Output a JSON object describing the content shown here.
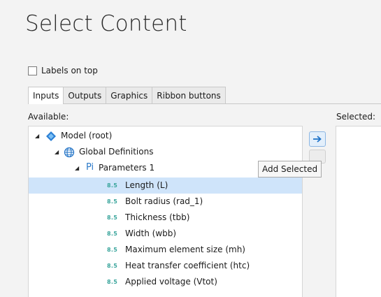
{
  "title": "Select Content",
  "labels_on_top": {
    "label": "Labels on top",
    "checked": false
  },
  "tabs": [
    {
      "label": "Inputs",
      "active": true
    },
    {
      "label": "Outputs",
      "active": false
    },
    {
      "label": "Graphics",
      "active": false
    },
    {
      "label": "Ribbon buttons",
      "active": false
    }
  ],
  "available_label": "Available:",
  "selected_label": "Selected:",
  "tooltip": "Add Selected",
  "tree": {
    "root": "Model (root)",
    "global_definitions": "Global Definitions",
    "parameters_group": "Parameters 1",
    "parameters_icon": "Pi",
    "param_badge": "8.5",
    "parameters": [
      {
        "label": "Length (L)",
        "selected": true
      },
      {
        "label": "Bolt radius (rad_1)",
        "selected": false
      },
      {
        "label": "Thickness (tbb)",
        "selected": false
      },
      {
        "label": "Width (wbb)",
        "selected": false
      },
      {
        "label": "Maximum element size (mh)",
        "selected": false
      },
      {
        "label": "Heat transfer coefficient (htc)",
        "selected": false
      },
      {
        "label": "Applied voltage (Vtot)",
        "selected": false
      }
    ]
  },
  "colors": {
    "accent": "#1f73c8",
    "selection": "#cfe4fa",
    "param_badge": "#3aa59c"
  }
}
